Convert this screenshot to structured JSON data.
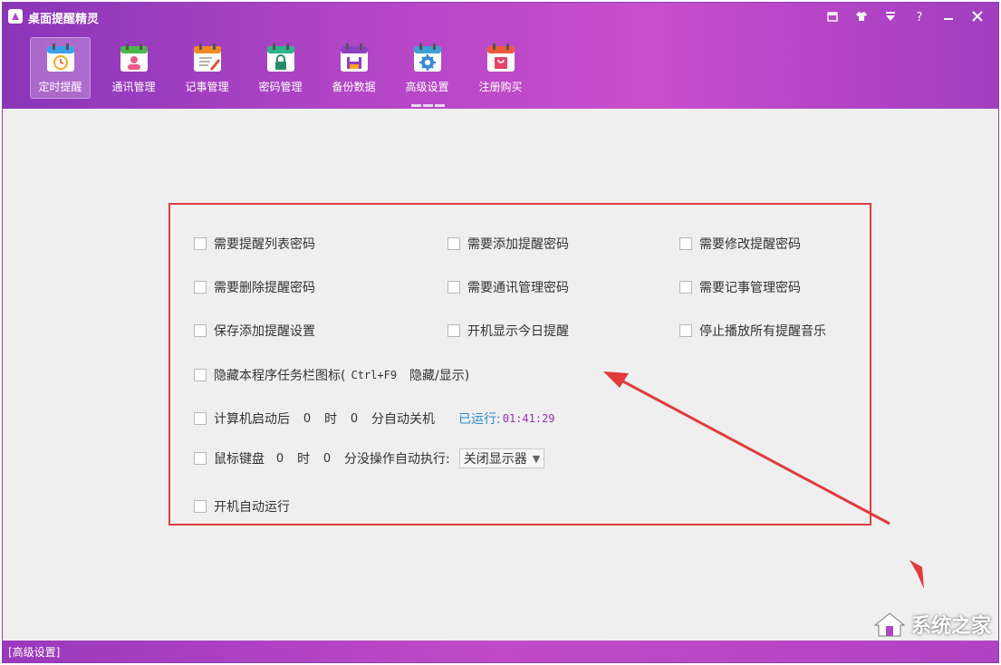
{
  "app": {
    "title": "桌面提醒精灵"
  },
  "toolbar": {
    "items": [
      {
        "label": "定时提醒",
        "icon": "clock-calendar-icon",
        "color": "#3aa0e8",
        "active": true
      },
      {
        "label": "通讯管理",
        "icon": "contacts-icon",
        "color": "#4bb84b"
      },
      {
        "label": "记事管理",
        "icon": "notepad-icon",
        "color": "#f08a24"
      },
      {
        "label": "密码管理",
        "icon": "lock-icon",
        "color": "#2fb38a"
      },
      {
        "label": "备份数据",
        "icon": "backup-icon",
        "color": "#8e3fc2"
      },
      {
        "label": "高级设置",
        "icon": "gear-icon",
        "color": "#3aa0d8",
        "selected": true
      },
      {
        "label": "注册购买",
        "icon": "cart-icon",
        "color": "#f05a3a"
      }
    ]
  },
  "options": {
    "list_password": "需要提醒列表密码",
    "add_password": "需要添加提醒密码",
    "edit_password": "需要修改提醒密码",
    "delete_password": "需要删除提醒密码",
    "contacts_password": "需要通讯管理密码",
    "notes_password": "需要记事管理密码",
    "save_add_settings": "保存添加提醒设置",
    "show_today_on_boot": "开机显示今日提醒",
    "stop_all_music": "停止播放所有提醒音乐",
    "hide_taskbar_icon": "隐藏本程序任务栏图标(",
    "hide_hotkey": "Ctrl+F9",
    "hide_hotkey_suffix": "隐藏/显示)",
    "auto_shutdown": {
      "prefix": "计算机启动后",
      "hours": "0",
      "hour_unit": "时",
      "minutes": "0",
      "suffix": "分自动关机",
      "running_label": "已运行:",
      "running_time": "01:41:29"
    },
    "idle_action": {
      "prefix": "鼠标键盘",
      "hours": "0",
      "hour_unit": "时",
      "minutes": "0",
      "suffix": "分没操作自动执行:",
      "selected": "关闭显示器"
    },
    "auto_start": "开机自动运行"
  },
  "status": {
    "left": "[高级设置]"
  },
  "watermark": {
    "text": "系统之家"
  },
  "colors": {
    "accent": "#b246c6",
    "highlight_border": "#e23b3b",
    "running_label": "#2a8ad4",
    "running_time": "#9a2fb8"
  }
}
